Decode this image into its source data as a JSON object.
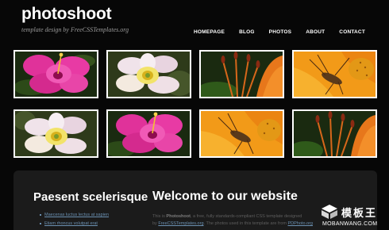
{
  "site": {
    "logo": "photoshoot",
    "tagline": "template design by FreeCSSTemplates.org"
  },
  "nav": {
    "items": [
      "HOMEPAGE",
      "BLOG",
      "PHOTOS",
      "ABOUT",
      "CONTACT"
    ]
  },
  "gallery": {
    "photos": [
      "pink-hibiscus",
      "white-yellow-flower",
      "orange-lily-stamens",
      "orange-lily-with-insect",
      "white-yellow-flower",
      "pink-hibiscus",
      "orange-lily-with-insect",
      "orange-lily-stamens"
    ]
  },
  "sidebar": {
    "title": "Paesent scelerisque",
    "links": [
      "Maecenas luctus lectus at sapien",
      "Etiam rhoncus volutpat erat"
    ]
  },
  "main": {
    "title": "Welcome to our website",
    "line1_pre": "This is ",
    "line1_name": "Photoshoot",
    "line1_post": ", a free, fully standards-compliant CSS template designed",
    "line2_pre": "by ",
    "line2_link": "FreeCSSTemplates.org",
    "line2_mid": ". The photos used in this template are from ",
    "line2_link2": "PDPhoto.org"
  },
  "watermark": {
    "cn": "模板王",
    "en": "MOBANWANG.COM"
  },
  "colors": {
    "background": "#070707",
    "panel": "#1b1b1b",
    "link": "#6a8fb0"
  }
}
